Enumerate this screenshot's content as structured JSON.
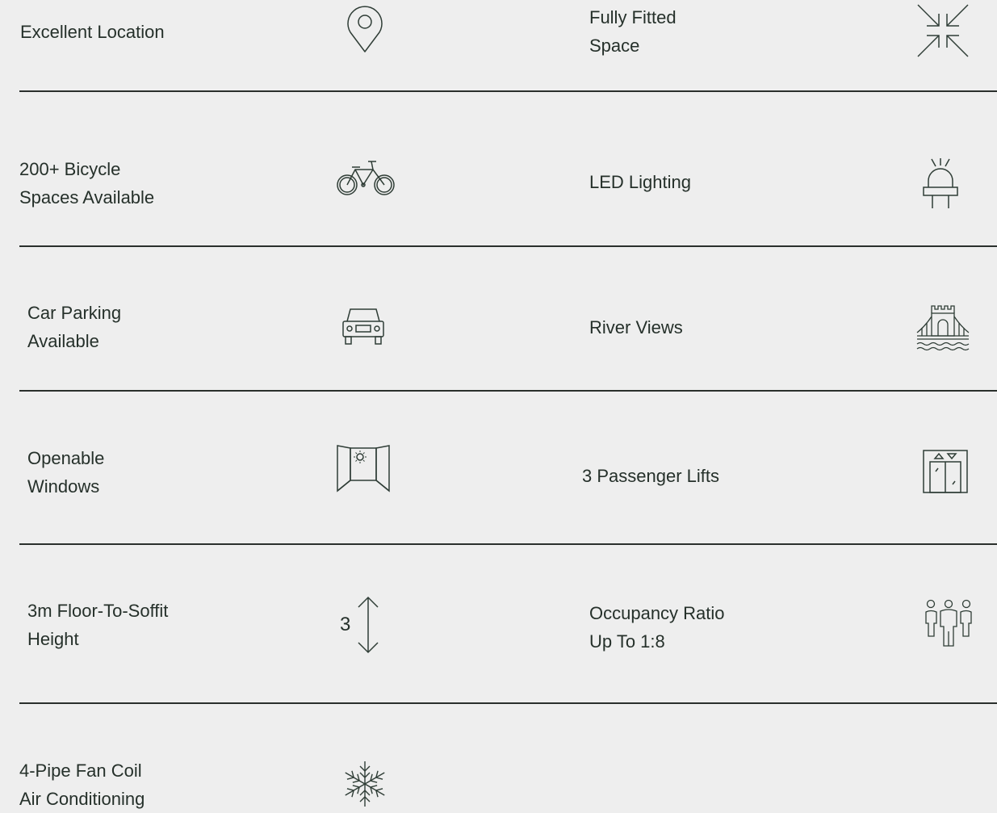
{
  "features": {
    "excellent_location": "Excellent Location",
    "fully_fitted": "Fully Fitted\nSpace",
    "bicycle": "200+ Bicycle\nSpaces Available",
    "led": "LED Lighting",
    "car_parking": "Car Parking\nAvailable",
    "river_views": "River Views",
    "windows": "Openable\nWindows",
    "lifts": "3 Passenger Lifts",
    "height": "3m Floor-To-Soffit\nHeight",
    "height_icon_number": "3",
    "occupancy": "Occupancy Ratio\nUp To 1:8",
    "air_conditioning": "4-Pipe Fan Coil\nAir Conditioning"
  },
  "icons": {
    "location": "map-pin-icon",
    "fitted": "fitted-space-arrows-icon",
    "bicycle": "bicycle-icon",
    "led": "led-bulb-icon",
    "car": "car-icon",
    "river": "river-bridge-icon",
    "window": "window-icon",
    "lift": "lift-icon",
    "height": "height-arrows-icon",
    "occupancy": "people-icon",
    "ac": "snowflake-icon"
  },
  "colors": {
    "background": "#eeeeee",
    "ink": "#25302a",
    "icon_stroke": "#2f3d36"
  }
}
